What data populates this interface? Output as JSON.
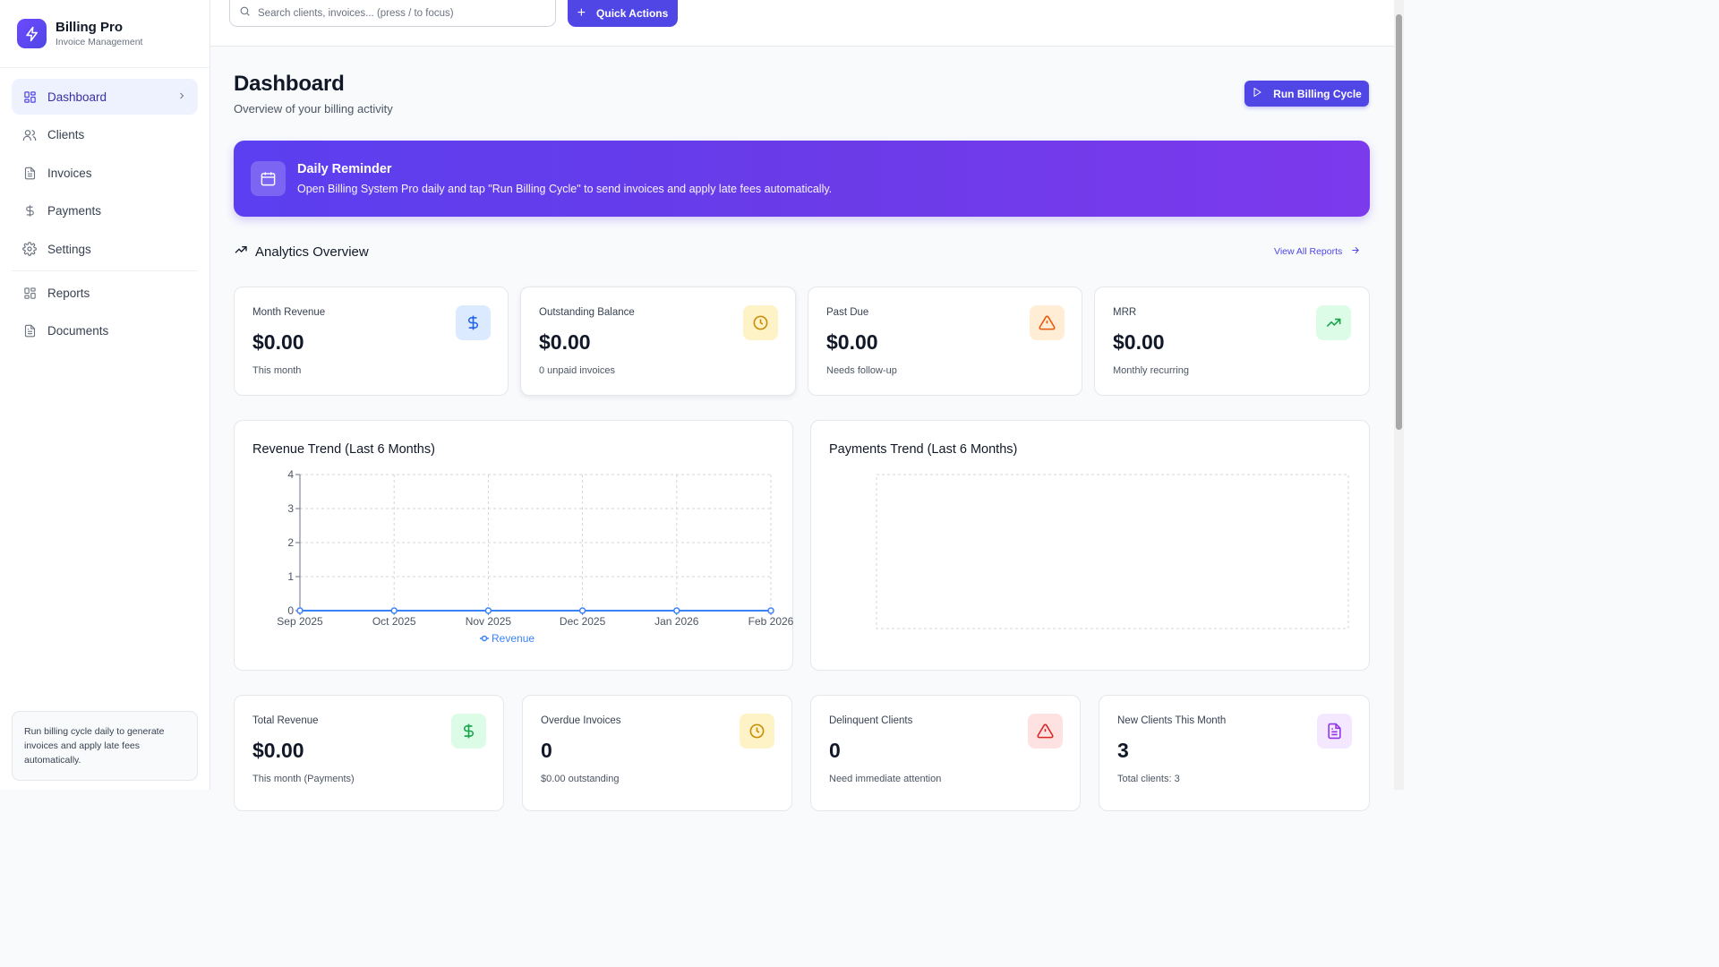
{
  "brand": {
    "title": "Billing Pro",
    "subtitle": "Invoice Management"
  },
  "nav": {
    "items": [
      {
        "label": "Dashboard",
        "icon": "grid-icon",
        "active": true
      },
      {
        "label": "Clients",
        "icon": "users-icon"
      },
      {
        "label": "Invoices",
        "icon": "file-icon"
      },
      {
        "label": "Payments",
        "icon": "dollar-icon"
      },
      {
        "label": "Settings",
        "icon": "gear-icon"
      },
      {
        "label": "Reports",
        "icon": "grid-icon"
      },
      {
        "label": "Documents",
        "icon": "file-icon"
      }
    ]
  },
  "sidebar_tip": "Run billing cycle daily to generate invoices and apply late fees automatically.",
  "search": {
    "placeholder": "Search clients, invoices... (press / to focus)"
  },
  "quick_actions": "Quick Actions",
  "page": {
    "title": "Dashboard",
    "subtitle": "Overview of your billing activity",
    "run_button": "Run Billing Cycle"
  },
  "reminder": {
    "title": "Daily Reminder",
    "text": "Open Billing System Pro daily and tap \"Run Billing Cycle\" to send invoices and apply late fees automatically."
  },
  "analytics": {
    "title": "Analytics Overview",
    "view_all": "View All Reports"
  },
  "kpis_top": [
    {
      "label": "Month Revenue",
      "value": "$0.00",
      "note": "This month",
      "icon": "dollar-icon",
      "color": "#2563eb",
      "bg": "#dbeafe"
    },
    {
      "label": "Outstanding Balance",
      "value": "$0.00",
      "note": "0 unpaid invoices",
      "icon": "clock-icon",
      "color": "#ca8a04",
      "bg": "#fef3c7"
    },
    {
      "label": "Past Due",
      "value": "$0.00",
      "note": "Needs follow-up",
      "icon": "alert-icon",
      "color": "#ea580c",
      "bg": "#ffedd5"
    },
    {
      "label": "MRR",
      "value": "$0.00",
      "note": "Monthly recurring",
      "icon": "trend-icon",
      "color": "#16a34a",
      "bg": "#dcfce7"
    }
  ],
  "panels": {
    "revenue_title": "Revenue Trend (Last 6 Months)",
    "payments_title": "Payments Trend (Last 6 Months)"
  },
  "chart_data": [
    {
      "type": "line",
      "title": "Revenue Trend (Last 6 Months)",
      "categories": [
        "Sep 2025",
        "Oct 2025",
        "Nov 2025",
        "Dec 2025",
        "Jan 2026",
        "Feb 2026"
      ],
      "series": [
        {
          "name": "Revenue",
          "values": [
            0,
            0,
            0,
            0,
            0,
            0
          ],
          "color": "#3b82f6"
        }
      ],
      "yticks": [
        "0",
        "1",
        "2",
        "3",
        "4"
      ],
      "ylim": [
        0,
        4
      ],
      "grid": true,
      "legend": "bottom"
    },
    {
      "type": "line",
      "title": "Payments Trend (Last 6 Months)",
      "categories": [],
      "series": [],
      "grid": true
    }
  ],
  "kpis_bottom": [
    {
      "label": "Total Revenue",
      "value": "$0.00",
      "note": "This month (Payments)",
      "icon": "dollar-icon",
      "color": "#16a34a",
      "bg": "#dcfce7"
    },
    {
      "label": "Overdue Invoices",
      "value": "0",
      "note": "$0.00 outstanding",
      "icon": "clock-icon",
      "color": "#ca8a04",
      "bg": "#fef3c7"
    },
    {
      "label": "Delinquent Clients",
      "value": "0",
      "note": "Need immediate attention",
      "icon": "alert-icon",
      "color": "#dc2626",
      "bg": "#fee2e2"
    },
    {
      "label": "New Clients This Month",
      "value": "3",
      "note": "Total clients: 3",
      "icon": "file-icon",
      "color": "#9333ea",
      "bg": "#f3e8ff"
    }
  ]
}
